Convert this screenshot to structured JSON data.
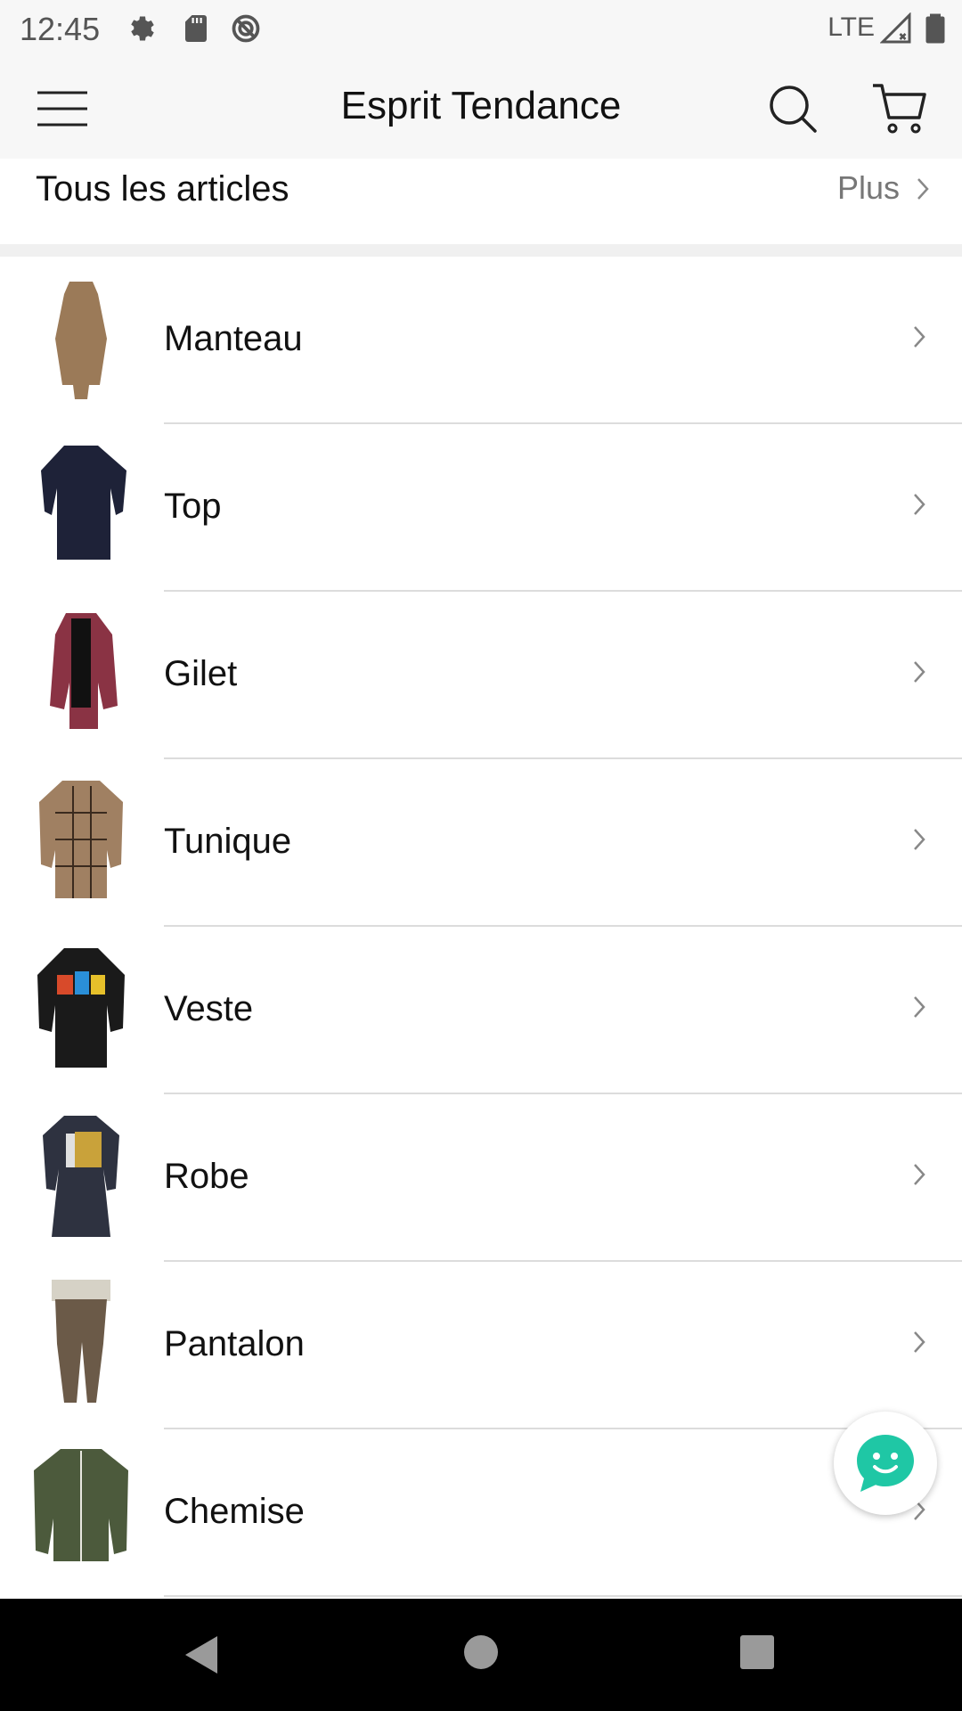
{
  "status_bar": {
    "time": "12:45",
    "network": "LTE",
    "icons": [
      "gear-icon",
      "sd-card-icon",
      "sync-disabled-icon",
      "signal-icon",
      "battery-icon"
    ]
  },
  "app_bar": {
    "title": "Esprit Tendance",
    "icons": [
      "menu-icon",
      "search-icon",
      "cart-icon"
    ]
  },
  "section": {
    "title": "Tous les articles",
    "more_label": "Plus"
  },
  "categories": [
    {
      "label": "Manteau",
      "thumb_color": "#9b7a58"
    },
    {
      "label": "Top",
      "thumb_color": "#1e2238"
    },
    {
      "label": "Gilet",
      "thumb_color": "#8a3344"
    },
    {
      "label": "Tunique",
      "thumb_color": "#a08062"
    },
    {
      "label": "Veste",
      "thumb_color": "#1a1a1a"
    },
    {
      "label": "Robe",
      "thumb_color": "#2e3240"
    },
    {
      "label": "Pantalon",
      "thumb_color": "#6b5a48"
    },
    {
      "label": "Chemise",
      "thumb_color": "#4c5a3c"
    }
  ],
  "colors": {
    "accent_chat": "#1fc7a5",
    "background": "#ffffff",
    "bar_background": "#f7f7f7"
  }
}
